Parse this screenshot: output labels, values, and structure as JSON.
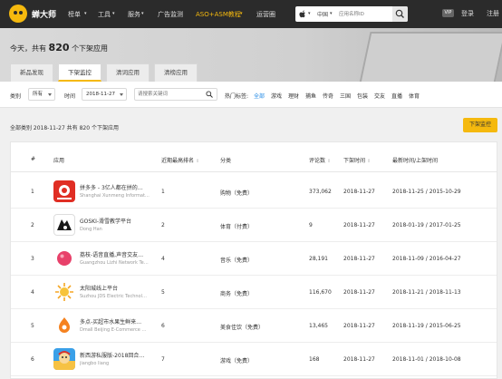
{
  "nav": {
    "logo_text": "蝉大师",
    "menus": [
      "榜单",
      "工具",
      "服务",
      "广告监测",
      "ASO+ASM教程",
      "运营圈"
    ],
    "search": {
      "os": "",
      "region": "中国",
      "placeholder": "应用名称ID"
    },
    "vip": "VIP",
    "login": "登录",
    "register": "注册"
  },
  "banner": {
    "title_prefix": "今天，共有",
    "title_count": "820",
    "title_suffix": "个下架应用",
    "tabs": [
      "新品发现",
      "下架监控",
      "清词应用",
      "清榜应用"
    ],
    "active_tab": 1
  },
  "filters": {
    "category_label": "类别",
    "category_value": "所有",
    "time_label": "时间",
    "time_value": "2018-11-27",
    "keyword_placeholder": "请搜索关键词",
    "hot_label": "热门标签:",
    "tags": [
      "全部",
      "游戏",
      "理财",
      "捕鱼",
      "传奇",
      "三国",
      "包装",
      "交友",
      "直播",
      "体育"
    ],
    "active_tag": 0
  },
  "summary": {
    "text": "全部类别 2018-11-27 共有 820 个下架应用"
  },
  "monitor_button": "下架监控",
  "table": {
    "headers": {
      "index": "#",
      "app": "应用",
      "rank": "近期最高排名",
      "category": "分类",
      "reviews": "评论数",
      "offline_time": "下架时间",
      "update_time": "最新时间/上架时间"
    },
    "rows": [
      {
        "index": "1",
        "name": "拼多多 - 3亿人都在拼的…",
        "dev": "Shanghai Xunmeng Informat…",
        "rank": "1",
        "category": "购物（免费）",
        "reviews": "373,062",
        "offline": "2018-11-27",
        "update": "2018-11-25 / 2015-10-29"
      },
      {
        "index": "2",
        "name": "GOSKI-滑雪教学平台",
        "dev": "Dong Han",
        "rank": "2",
        "category": "体育（付费）",
        "reviews": "9",
        "offline": "2018-11-27",
        "update": "2018-01-19 / 2017-01-25"
      },
      {
        "index": "3",
        "name": "荔枝-语音直播,声音交友…",
        "dev": "Guangzhou Lizhi Network Te…",
        "rank": "4",
        "category": "音乐（免费）",
        "reviews": "28,191",
        "offline": "2018-11-27",
        "update": "2018-11-09 / 2016-04-27"
      },
      {
        "index": "4",
        "name": "太阳城线上平台",
        "dev": "Suzhou JDS Electric Technol…",
        "rank": "5",
        "category": "商务（免费）",
        "reviews": "116,670",
        "offline": "2018-11-27",
        "update": "2018-11-21 / 2018-11-13"
      },
      {
        "index": "5",
        "name": "多点-买超市水果生鲜来…",
        "dev": "Dmall Beijing E-Commerce …",
        "rank": "6",
        "category": "美食佳饮（免费）",
        "reviews": "13,465",
        "offline": "2018-11-27",
        "update": "2018-11-19 / 2015-06-25"
      },
      {
        "index": "6",
        "name": "新西游私服版-2018回合…",
        "dev": "jiangbo liang",
        "rank": "7",
        "category": "游戏（免费）",
        "reviews": "168",
        "offline": "2018-11-27",
        "update": "2018-11-01 / 2018-10-08"
      }
    ]
  },
  "colors": {
    "accent": "#f5b90e",
    "nav_bg": "#2b2b2b",
    "link": "#1e88e5"
  }
}
